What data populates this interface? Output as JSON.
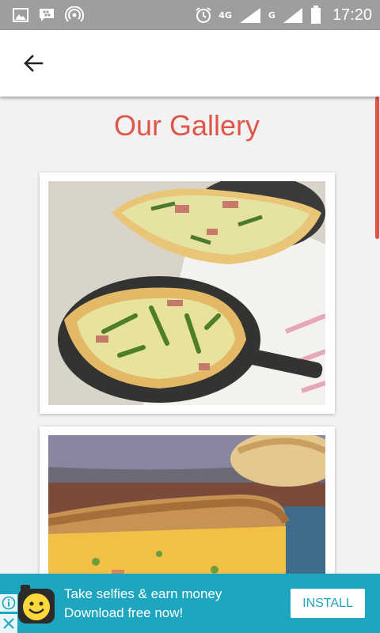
{
  "status_bar": {
    "time": "17:20",
    "network_primary": "4G",
    "network_secondary": "G",
    "icons_left": [
      "gallery-icon",
      "bbm-icon",
      "hotspot-icon"
    ],
    "icons_right": [
      "alarm-icon",
      "data-arrows-icon",
      "signal-icon",
      "signal-icon",
      "battery-icon"
    ]
  },
  "app_bar": {
    "back_icon": "arrow-left-icon"
  },
  "page": {
    "title": "Our Gallery",
    "accent_color": "#e0554a"
  },
  "gallery": {
    "images": [
      {
        "alt": "Two quiches in cast iron skillets"
      },
      {
        "alt": "Slice of cheesy quiche"
      }
    ]
  },
  "ad": {
    "line1": "Take selfies & earn money",
    "line2": "Download free now!",
    "install_label": "INSTALL",
    "brand_color": "#1ea6c0",
    "icons": [
      "info-icon",
      "close-icon",
      "smiley-app-icon"
    ]
  }
}
